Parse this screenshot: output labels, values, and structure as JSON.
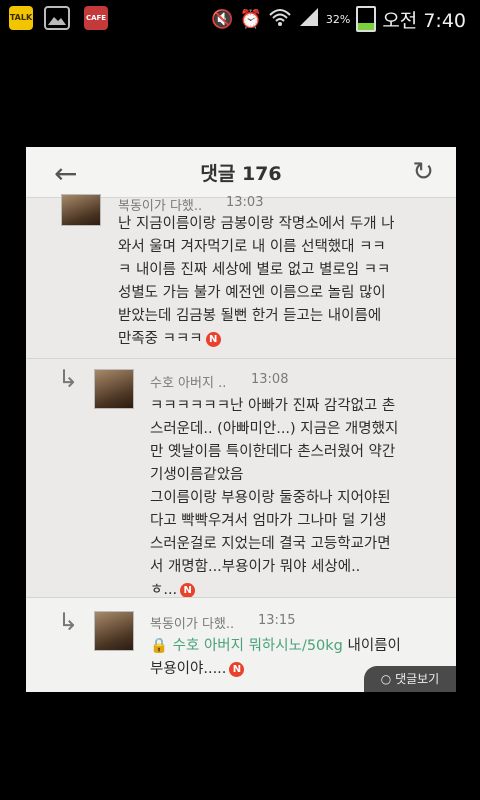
{
  "status_bar": {
    "app_icons": [
      "talk-app-icon",
      "gallery-icon",
      "cafe-app-icon"
    ],
    "app_labels": {
      "talk": "TALK",
      "cafe": "CAFE"
    },
    "battery": "32%",
    "time": "오전 7:40"
  },
  "header": {
    "title": "댓글 176"
  },
  "comments": [
    {
      "author": "복동이가 다했..",
      "time": "13:03",
      "lines": [
        "난 지금이름이랑 금봉이랑 작명소에서 두개 나",
        "와서 울며 겨자먹기로 내 이름 선택했대 ㅋㅋ",
        "ㅋ 내이름 진짜 세상에 별로 없고 별로임 ㅋㅋ",
        "성별도 가늠 불가 예전엔 이름으로 놀림 많이",
        "받았는데 김금봉 될뻔 한거 듣고는 내이름에",
        "만족중 ㅋㅋㅋ"
      ],
      "badge": "N"
    },
    {
      "author": "수호 아버지 ..",
      "time": "13:08",
      "lines": [
        "ㅋㅋㅋㅋㅋㅋ난 아빠가 진짜 감각없고 촌",
        "스러운데.. (아빠미안...) 지금은 개명했지",
        "만 옛날이름 특이한데다 촌스러웠어 약간",
        "기생이름같았음",
        " 그이름이랑 부용이랑 둘중하나 지어야된",
        "다고 빡빡우겨서 엄마가 그나마 덜 기생",
        "스러운걸로 지었는데 결국 고등학교가면",
        "서 개명함...부용이가 뭐야 세상에..",
        "ㅎ..."
      ],
      "badge": "N"
    },
    {
      "author": "복동이가 다했..",
      "time": "13:15",
      "mention": "수호 아버지 뭐하시노/50kg",
      "lines": [
        "내이름이",
        "부용이야....."
      ],
      "badge": "N"
    }
  ],
  "more_button": "댓글보기"
}
